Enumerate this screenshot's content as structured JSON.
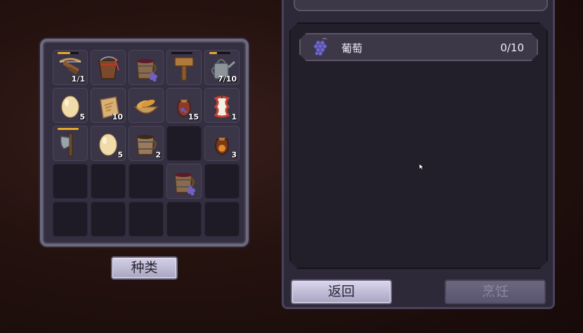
{
  "inventory": {
    "slots": [
      {
        "item": "crossbow-icon",
        "count": "1/1",
        "durability": 0.6
      },
      {
        "item": "fishing-bucket-icon",
        "count": "",
        "durability": null
      },
      {
        "item": "grape-juice-mug-icon",
        "count": "",
        "durability": null
      },
      {
        "item": "wooden-mallet-icon",
        "count": "",
        "durability": 0.0
      },
      {
        "item": "watering-can-icon",
        "count": "7/10",
        "durability": 0.35
      },
      {
        "item": "egg-icon",
        "count": "5",
        "durability": null
      },
      {
        "item": "flour-sack-icon",
        "count": "10",
        "durability": null
      },
      {
        "item": "bread-basket-icon",
        "count": "",
        "durability": null
      },
      {
        "item": "seed-pouch-icon",
        "count": "15",
        "durability": null
      },
      {
        "item": "apple-core-icon",
        "count": "1",
        "durability": null
      },
      {
        "item": "axe-icon",
        "count": "",
        "durability": 1.0
      },
      {
        "item": "egg-icon",
        "count": "5",
        "durability": null
      },
      {
        "item": "wooden-mug-icon",
        "count": "2",
        "durability": null
      },
      {
        "item": "",
        "count": "",
        "durability": null
      },
      {
        "item": "spice-pouch-icon",
        "count": "3",
        "durability": null
      },
      {
        "item": "",
        "count": "",
        "durability": null
      },
      {
        "item": "",
        "count": "",
        "durability": null
      },
      {
        "item": "",
        "count": "",
        "durability": null
      },
      {
        "item": "grape-juice-mug-icon",
        "count": "",
        "durability": null
      },
      {
        "item": "",
        "count": "",
        "durability": null
      },
      {
        "item": "",
        "count": "",
        "durability": null
      },
      {
        "item": "",
        "count": "",
        "durability": null
      },
      {
        "item": "",
        "count": "",
        "durability": null
      },
      {
        "item": "",
        "count": "",
        "durability": null
      },
      {
        "item": "",
        "count": "",
        "durability": null
      }
    ],
    "category_button": "种类"
  },
  "recipe": {
    "ingredient": {
      "icon": "grapes-icon",
      "name": "葡萄",
      "count": "0/10"
    },
    "back_button": "返回",
    "cook_button": "烹饪"
  },
  "colors": {
    "panel": "#2e2938",
    "button_light": "#d3d0e6",
    "button_disabled": "#625d78",
    "durability": "#e6a52a"
  }
}
